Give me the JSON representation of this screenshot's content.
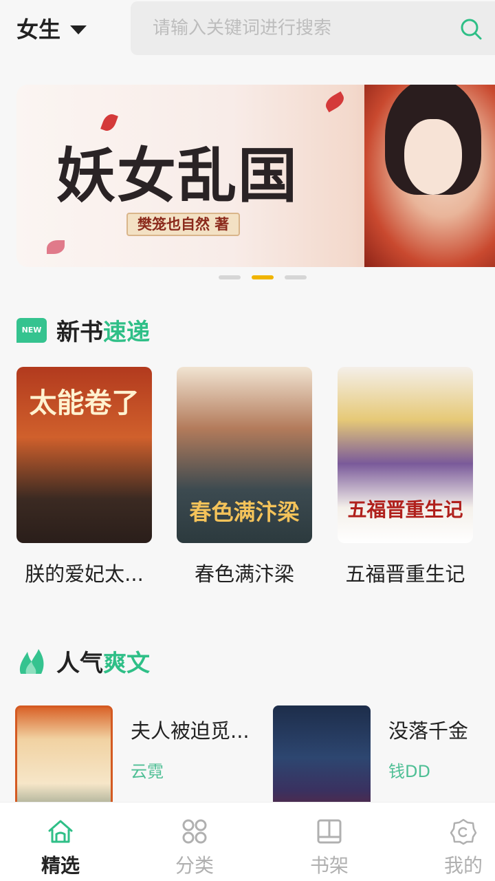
{
  "header": {
    "gender_label": "女生",
    "search_placeholder": "请输入关键词进行搜索"
  },
  "banner": {
    "title": "妖女乱国",
    "author_tag": "樊笼也自然 著",
    "active_dot": 1,
    "dot_count": 3
  },
  "sections": {
    "new_books": {
      "title_main": "新书",
      "title_accent": "速递",
      "badge": "NEW"
    },
    "popular": {
      "title_main": "人气",
      "title_accent": "爽文"
    }
  },
  "new_books": [
    {
      "name": "朕的爱妃太...",
      "cover_text": "太能卷了"
    },
    {
      "name": "春色满汴梁",
      "cover_text": "春色满汴梁"
    },
    {
      "name": "五福晋重生记",
      "cover_text": "五福晋重生记"
    }
  ],
  "popular_books": [
    {
      "title": "夫人被迫觅...",
      "author": "云霓"
    },
    {
      "title": "没落千金",
      "author": "钱DD"
    }
  ],
  "bottom_nav": [
    {
      "label": "精选",
      "icon": "home-icon",
      "active": true
    },
    {
      "label": "分类",
      "icon": "category-icon",
      "active": false
    },
    {
      "label": "书架",
      "icon": "bookshelf-icon",
      "active": false
    },
    {
      "label": "我的",
      "icon": "profile-icon",
      "active": false
    }
  ],
  "colors": {
    "accent": "#2fbf87",
    "dot_active": "#f0b400",
    "author": "#4fbf95"
  }
}
